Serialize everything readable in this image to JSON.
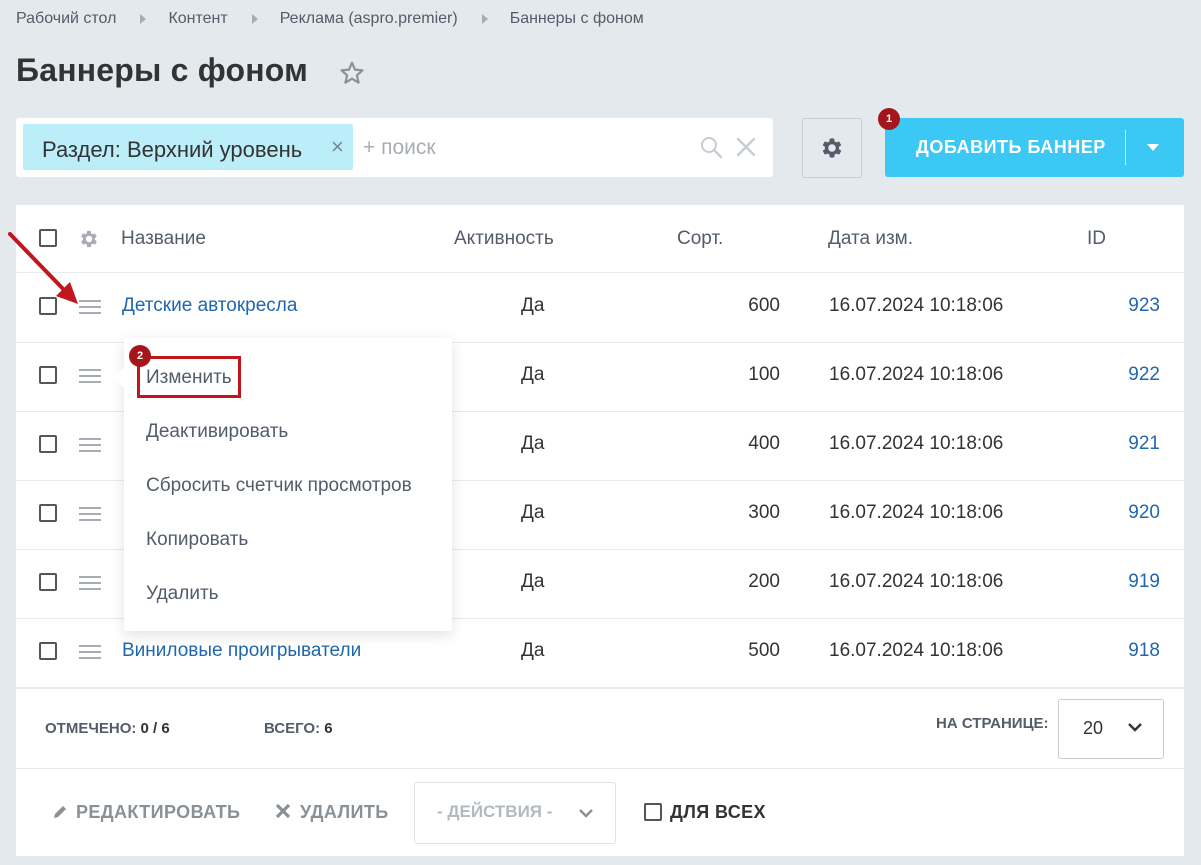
{
  "breadcrumb": [
    "Рабочий стол",
    "Контент",
    "Реклама (aspro.premier)",
    "Баннеры с фоном"
  ],
  "page_title": "Баннеры с фоном",
  "filter": {
    "chip_label": "Раздел: Верхний уровень",
    "chip_close": "×",
    "search_placeholder": "+ поиск"
  },
  "add_button": {
    "label": "ДОБАВИТЬ БАННЕР"
  },
  "badges": {
    "first": "1",
    "second": "2"
  },
  "table": {
    "headers": {
      "name": "Название",
      "active": "Активность",
      "sort": "Сорт.",
      "date": "Дата изм.",
      "id": "ID"
    },
    "rows": [
      {
        "name": "Детские автокресла",
        "active": "Да",
        "sort": "600",
        "date": "16.07.2024 10:18:06",
        "id": "923"
      },
      {
        "name": "",
        "active": "Да",
        "sort": "100",
        "date": "16.07.2024 10:18:06",
        "id": "922"
      },
      {
        "name": "",
        "active": "Да",
        "sort": "400",
        "date": "16.07.2024 10:18:06",
        "id": "921"
      },
      {
        "name": "",
        "active": "Да",
        "sort": "300",
        "date": "16.07.2024 10:18:06",
        "id": "920"
      },
      {
        "name": "",
        "active": "Да",
        "sort": "200",
        "date": "16.07.2024 10:18:06",
        "id": "919"
      },
      {
        "name": "Виниловые проигрыватели",
        "active": "Да",
        "sort": "500",
        "date": "16.07.2024 10:18:06",
        "id": "918"
      }
    ]
  },
  "footer": {
    "selected_label": "ОТМЕЧЕНО:",
    "selected_value": "0 / 6",
    "total_label": "ВСЕГО:",
    "total_value": "6",
    "per_page_label": "НА СТРАНИЦЕ:",
    "per_page_value": "20"
  },
  "action_bar": {
    "edit": "РЕДАКТИРОВАТЬ",
    "delete": "УДАЛИТЬ",
    "actions_select": "- ДЕЙСТВИЯ -",
    "for_all": "ДЛЯ ВСЕХ"
  },
  "context_menu": {
    "items": [
      "Изменить",
      "Деактивировать",
      "Сбросить счетчик просмотров",
      "Копировать",
      "Удалить"
    ]
  },
  "colors": {
    "accent": "#3bc8f5",
    "link": "#2067b0",
    "highlight": "#c0161c",
    "badge": "#a4151c"
  }
}
